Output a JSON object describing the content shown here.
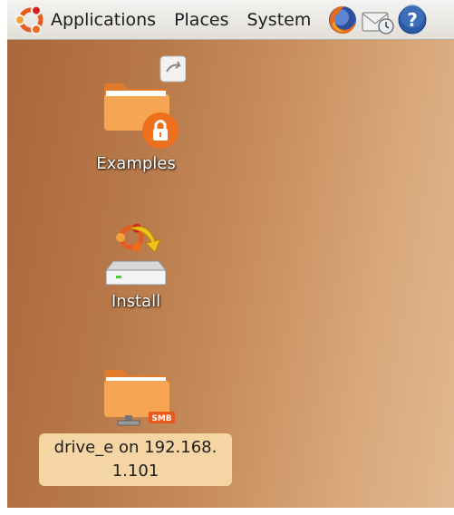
{
  "panel": {
    "menus": [
      "Applications",
      "Places",
      "System"
    ],
    "icons": [
      "ubuntu-logo-icon",
      "firefox-icon",
      "mail-notification-icon",
      "help-icon"
    ]
  },
  "desktop": {
    "icons": [
      {
        "label": "Examples",
        "icon": "folder-link-locked-icon"
      },
      {
        "label": "Install",
        "icon": "installer-drive-icon"
      },
      {
        "label_line1": "drive_e on 192.168.",
        "label_line2": "1.101",
        "badge": "SMB",
        "icon": "network-share-folder-icon",
        "selected": true
      }
    ]
  },
  "colors": {
    "panel": "#e8e5e0",
    "desktop": "#c08a58",
    "selection": "#f6d5a4",
    "folder": "#f39c4a",
    "accent": "#e8591a"
  }
}
